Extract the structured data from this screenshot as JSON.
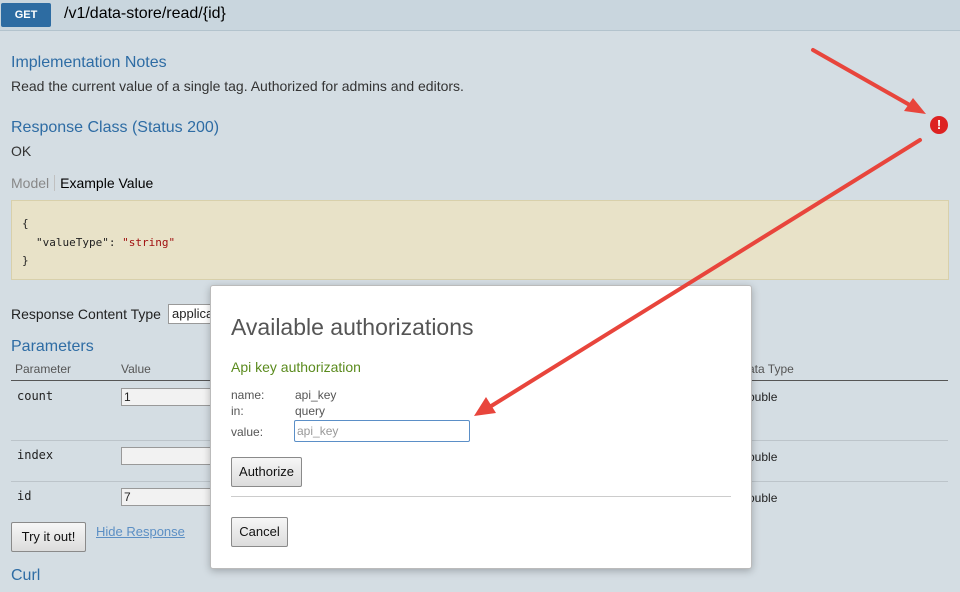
{
  "endpoint": {
    "method": "GET",
    "path": "/v1/data-store/read/{id}"
  },
  "implementation_notes": {
    "heading": "Implementation Notes",
    "text": "Read the current value of a single tag. Authorized for admins and editors."
  },
  "response_class": {
    "heading": "Response Class (Status 200)",
    "status": "OK",
    "tabs": {
      "model": "Model",
      "example": "Example Value"
    },
    "example_lines": [
      "{",
      "\"valueType\"",
      ": ",
      "\"string\"",
      "}"
    ]
  },
  "response_content_type": {
    "label": "Response Content Type",
    "selected": "applica"
  },
  "parameters": {
    "heading": "Parameters",
    "columns": [
      "Parameter",
      "Value",
      "ata Type"
    ],
    "rows": [
      {
        "name": "count",
        "value": "1",
        "type": "ouble"
      },
      {
        "name": "index",
        "value": "",
        "type": "ouble"
      },
      {
        "name": "id",
        "value": "7",
        "type": "ouble"
      }
    ]
  },
  "actions": {
    "try": "Try it out!",
    "hide": "Hide Response"
  },
  "curl": {
    "heading": "Curl"
  },
  "modal": {
    "title": "Available authorizations",
    "subtitle": "Api key authorization",
    "name_label": "name:",
    "name_value": "api_key",
    "in_label": "in:",
    "in_value": "query",
    "value_label": "value:",
    "value_placeholder": "api_key",
    "authorize": "Authorize",
    "cancel": "Cancel"
  },
  "colors": {
    "accent": "#2e6ca4",
    "badge": "#2d6ca2",
    "alert": "#dd2222",
    "arrow": "#e8453c"
  },
  "icons": {
    "alert": "exclamation-circle-icon"
  },
  "alert_glyph": "!"
}
